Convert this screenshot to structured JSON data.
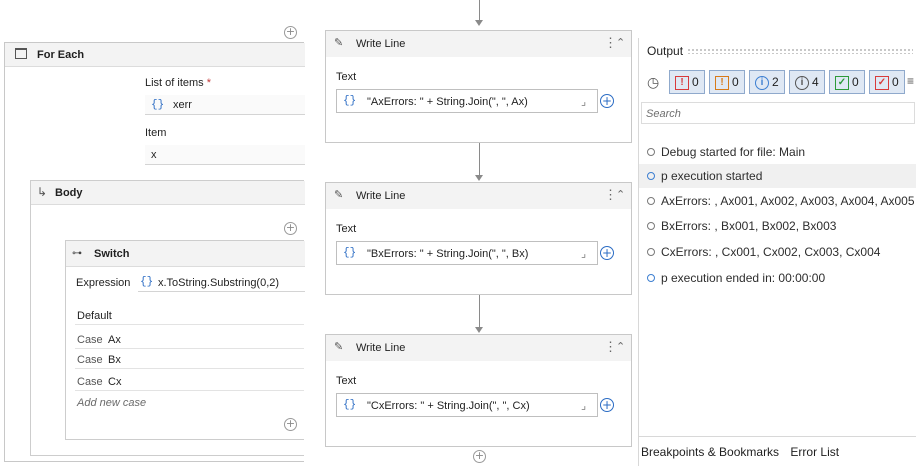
{
  "foreach": {
    "title": "For Each",
    "list_label": "List of items",
    "required_mark": "*",
    "list_value_brace": "{}",
    "list_value": "xerr",
    "item_label": "Item",
    "item_value": "x"
  },
  "body": {
    "label": "Body",
    "arrow": "↳"
  },
  "switch": {
    "title": "Switch",
    "expression_label": "Expression",
    "expression_brace": "{}",
    "expression_value": "x.ToString.Substring(0,2)",
    "default_label": "Default",
    "cases": [
      {
        "prefix": "Case",
        "value": "Ax"
      },
      {
        "prefix": "Case",
        "value": "Bx"
      },
      {
        "prefix": "Case",
        "value": "Cx"
      }
    ],
    "add_case": "Add new case"
  },
  "write_lines": [
    {
      "title": "Write Line",
      "text_label": "Text",
      "brace": "{}",
      "expression": "\"AxErrors: \" + String.Join(\", \", Ax)"
    },
    {
      "title": "Write Line",
      "text_label": "Text",
      "brace": "{}",
      "expression": "\"BxErrors: \" + String.Join(\", \", Bx)"
    },
    {
      "title": "Write Line",
      "text_label": "Text",
      "brace": "{}",
      "expression": "\"CxErrors: \" + String.Join(\", \", Cx)"
    }
  ],
  "output": {
    "title": "Output",
    "filters": [
      {
        "icon": "warning-icon",
        "count": "0",
        "color": "#d83b3b"
      },
      {
        "icon": "error-icon",
        "count": "0",
        "color": "#d87a1a"
      },
      {
        "icon": "info-icon",
        "count": "2",
        "color": "#3d7fd1"
      },
      {
        "icon": "trace-icon",
        "count": "4",
        "color": "#555555"
      },
      {
        "icon": "success-icon",
        "count": "0",
        "color": "#2e9a3a"
      },
      {
        "icon": "failure-icon",
        "count": "0",
        "color": "#d83b3b"
      }
    ],
    "search_placeholder": "Search",
    "messages": [
      {
        "text": "Debug started for file: Main",
        "kind": "trace"
      },
      {
        "text": "p execution started",
        "kind": "info"
      },
      {
        "text": "AxErrors: , Ax001, Ax002, Ax003, Ax004, Ax005",
        "kind": "trace"
      },
      {
        "text": "BxErrors: , Bx001, Bx002, Bx003",
        "kind": "trace"
      },
      {
        "text": "CxErrors: , Cx001, Cx002, Cx003, Cx004",
        "kind": "trace"
      },
      {
        "text": "p execution ended in: 00:00:00",
        "kind": "info"
      }
    ],
    "bottom_tabs": [
      "Breakpoints & Bookmarks",
      "Error List"
    ]
  },
  "colors": {
    "accent": "#2b6cc4",
    "info": "#3d7fd1",
    "error": "#d83b3b",
    "success": "#2e9a3a"
  }
}
